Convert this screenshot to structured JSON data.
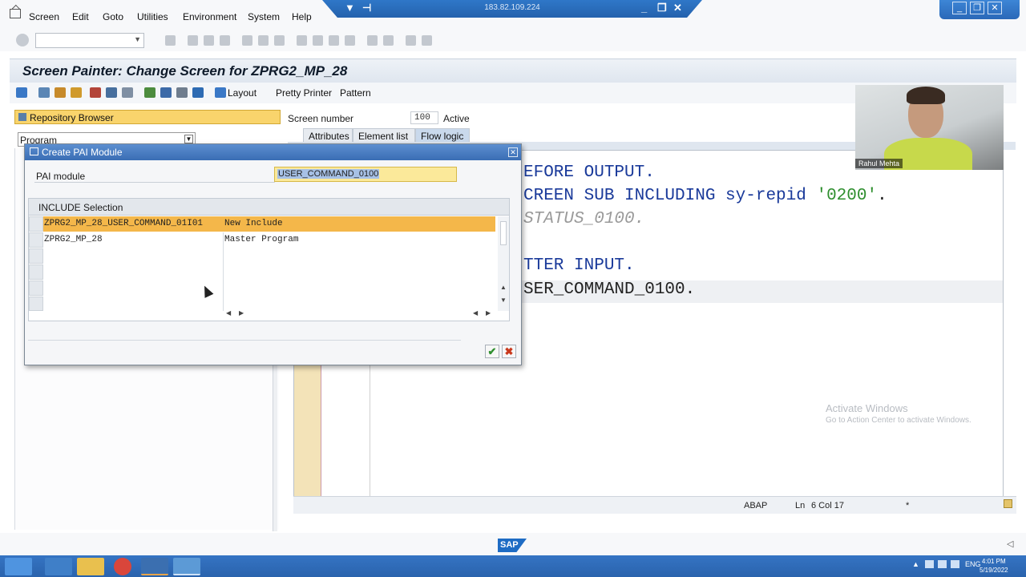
{
  "menu": [
    "Screen",
    "Edit",
    "Goto",
    "Utilities",
    "Environment",
    "System",
    "Help"
  ],
  "remote": {
    "ip": "183.82.109.224",
    "controls": [
      "▼",
      "⊣",
      "_",
      "❐",
      "✕"
    ]
  },
  "window_controls": [
    "_",
    "❐",
    "✕"
  ],
  "title": "Screen Painter: Change Screen for ZPRG2_MP_28",
  "app_toolbar": {
    "layout": "Layout",
    "pretty_printer": "Pretty Printer",
    "pattern": "Pattern"
  },
  "repo_browser": "Repository Browser",
  "program_select": "Program",
  "screen": {
    "label": "Screen number",
    "number": "100",
    "status": "Active"
  },
  "tabs": [
    "Attributes",
    "Element list",
    "Flow logic"
  ],
  "code": {
    "line1": "EFORE OUTPUT.",
    "line2_a": "CREEN SUB INCLUDING sy-repid ",
    "line2_b": "'0200'",
    "line2_c": ".",
    "line3": "STATUS_0100.",
    "line4": "TTER INPUT.",
    "line5": "SER_COMMAND_0100."
  },
  "statusbar": {
    "lang": "ABAP",
    "pos_label": "Ln",
    "pos": "6 Col  17",
    "mark": "*"
  },
  "watermark": {
    "line1": "Activate Windows",
    "line2": "Go to Action Center to activate Windows."
  },
  "webcam": {
    "name": "Rahul Mehta"
  },
  "dialog": {
    "title": "Create PAI Module",
    "pai_label": "PAI module",
    "pai_value": "USER_COMMAND_0100",
    "include_header": "INCLUDE Selection",
    "rows": [
      {
        "name": "ZPRG2_MP_28_USER_COMMAND_01I01",
        "desc": "New Include"
      },
      {
        "name": "ZPRG2_MP_28",
        "desc": "Master Program"
      }
    ],
    "ok_glyph": "✔",
    "cancel_glyph": "✖"
  },
  "sap_logo": "SAP",
  "tray": {
    "lang": "ENG",
    "time": "4:01 PM",
    "date": "5/19/2022"
  },
  "colors": {
    "highlight_row": "#f4b74a",
    "repo_button": "#f9d46c",
    "dialog_title": "#3a6db4",
    "taskbar": "#2a63ad"
  }
}
